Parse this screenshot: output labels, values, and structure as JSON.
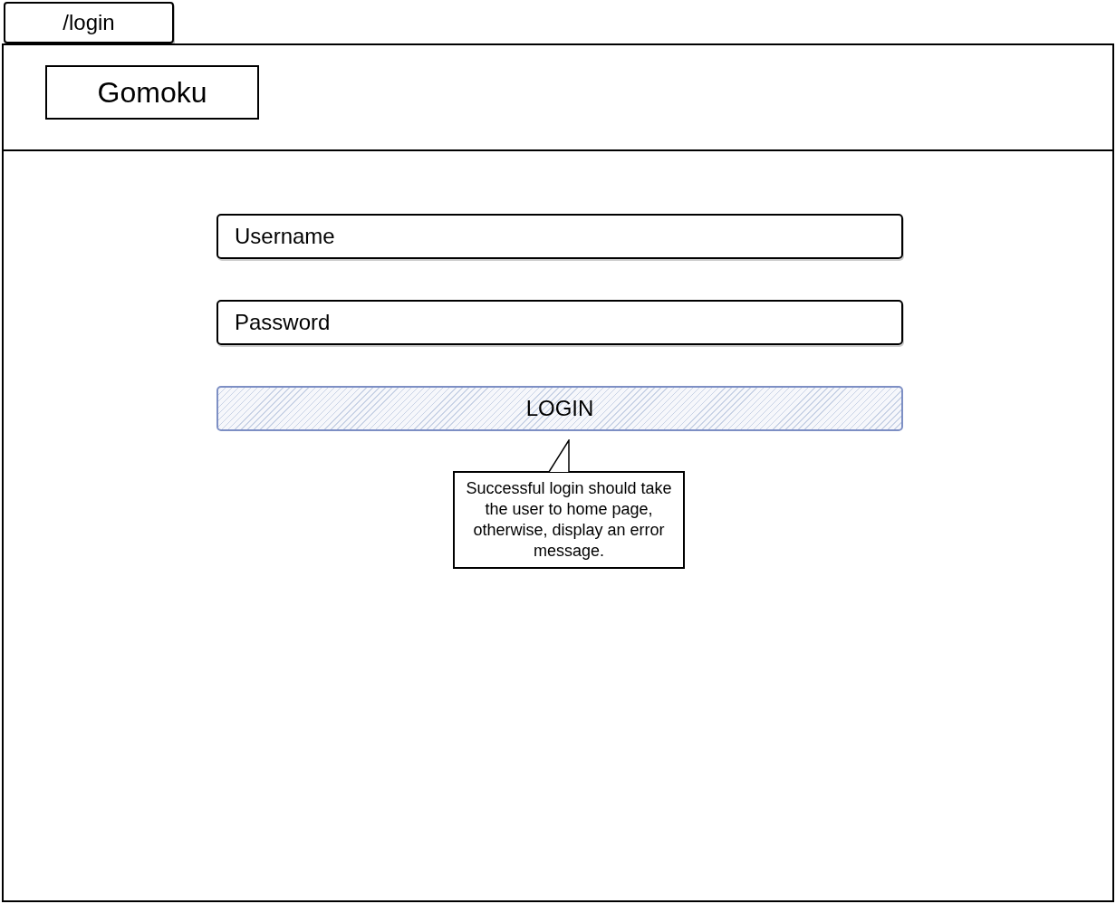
{
  "tab": {
    "label": "/login"
  },
  "header": {
    "logo": "Gomoku"
  },
  "form": {
    "fields": [
      {
        "placeholder": "Username"
      },
      {
        "placeholder": "Password"
      }
    ],
    "button": "LOGIN"
  },
  "callout": {
    "text": "Successful login should take the user to home page, otherwise, display an error message."
  }
}
